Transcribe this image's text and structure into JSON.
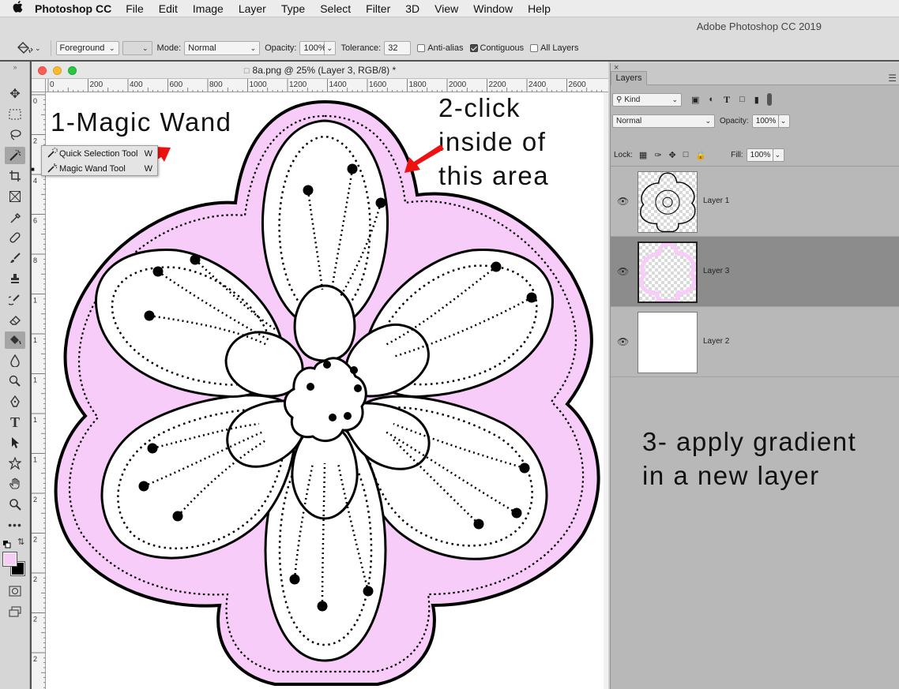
{
  "menubar": {
    "apple_icon": "apple-icon",
    "app_name": "Photoshop CC",
    "items": [
      "File",
      "Edit",
      "Image",
      "Layer",
      "Type",
      "Select",
      "Filter",
      "3D",
      "View",
      "Window",
      "Help"
    ]
  },
  "app_title": "Adobe Photoshop CC 2019",
  "options": {
    "tool_icon": "paint-bucket-icon",
    "fill_source": "Foreground",
    "mode_label": "Mode:",
    "mode_value": "Normal",
    "opacity_label": "Opacity:",
    "opacity_value": "100%",
    "tolerance_label": "Tolerance:",
    "tolerance_value": "32",
    "anti_alias_label": "Anti-alias",
    "anti_alias_checked": false,
    "contiguous_label": "Contiguous",
    "contiguous_checked": true,
    "all_layers_label": "All Layers",
    "all_layers_checked": false
  },
  "document": {
    "title": "8a.png @ 25% (Layer 3, RGB/8) *",
    "ruler_h": [
      "0",
      "200",
      "400",
      "600",
      "800",
      "1000",
      "1200",
      "1400",
      "1600",
      "1800",
      "2000",
      "2200",
      "2400",
      "2600"
    ],
    "ruler_v": [
      "0",
      "2",
      "4",
      "6",
      "8",
      "1",
      "1",
      "1",
      "1",
      "1",
      "2",
      "2",
      "2",
      "2",
      "2",
      "3"
    ],
    "fill_color": "#f8ccf8"
  },
  "flyout": {
    "items": [
      {
        "label": "Quick Selection Tool",
        "shortcut": "W",
        "icon": "quick-selection-icon"
      },
      {
        "label": "Magic Wand Tool",
        "shortcut": "W",
        "icon": "magic-wand-icon"
      }
    ]
  },
  "annotations": {
    "step1": "1-Magic Wand",
    "step2": "2-click\ninside of\nthis area",
    "step3": "3- apply gradient\nin a new layer",
    "arrow_color": "#ee1111"
  },
  "layers_panel": {
    "tab": "Layers",
    "filter_kind": "Kind",
    "blend_mode": "Normal",
    "opacity_label": "Opacity:",
    "opacity_value": "100%",
    "lock_label": "Lock:",
    "fill_label": "Fill:",
    "fill_value": "100%",
    "layers": [
      {
        "name": "Layer 1",
        "visible": true,
        "selected": false
      },
      {
        "name": "Layer 3",
        "visible": true,
        "selected": true
      },
      {
        "name": "Layer 2",
        "visible": true,
        "selected": false
      }
    ]
  },
  "colors": {
    "foreground": "#f6cdf6",
    "background": "#000000"
  }
}
